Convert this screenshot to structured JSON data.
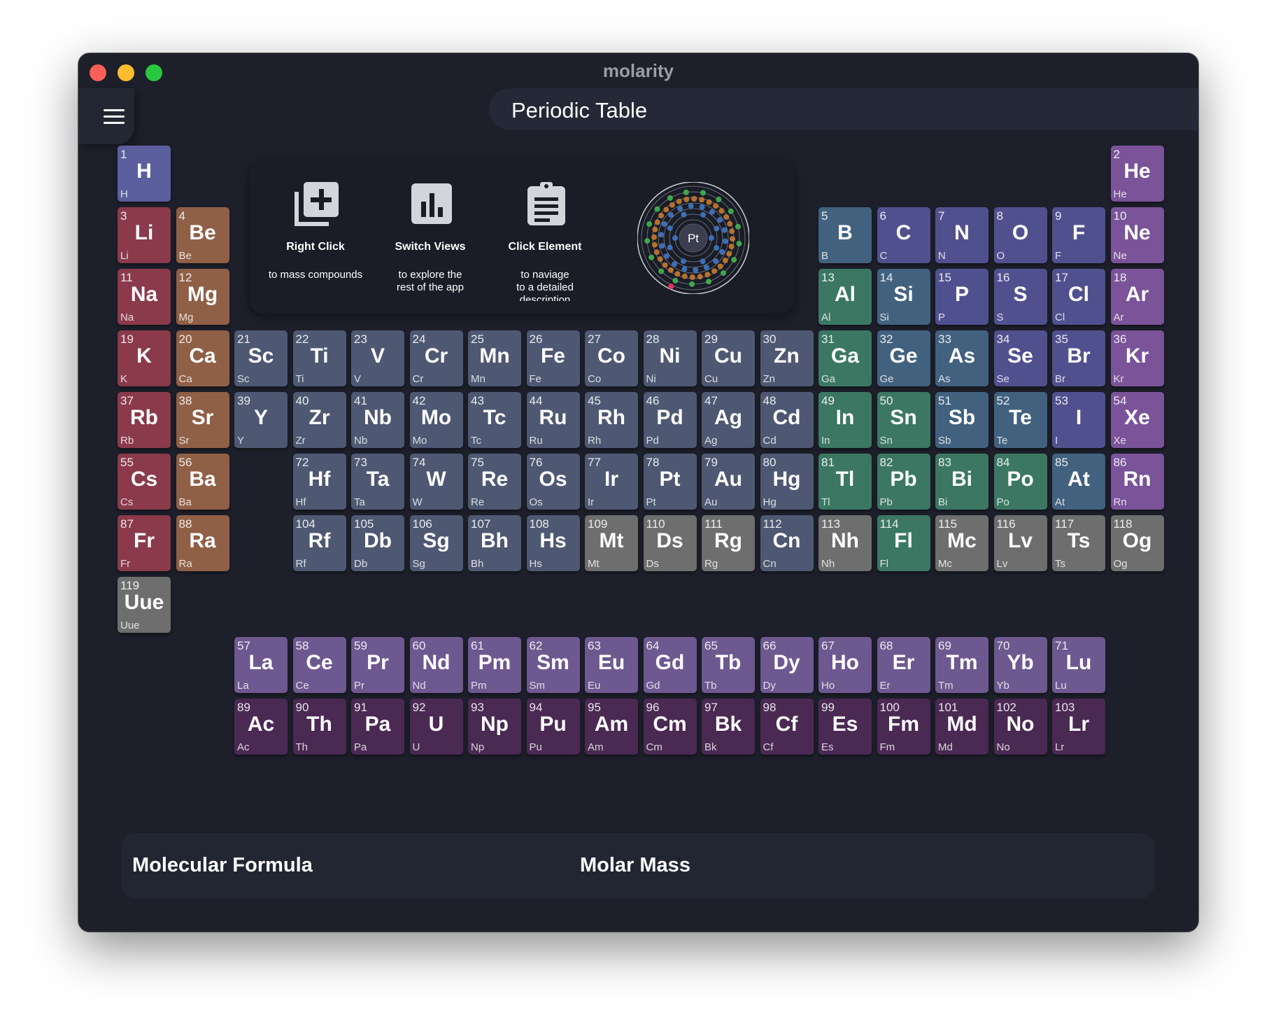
{
  "window": {
    "title": "molarity"
  },
  "header": {
    "title": "Periodic Table",
    "menu_icon": "hamburger-menu-icon"
  },
  "info": {
    "items": [
      {
        "icon": "add-box-icon",
        "title": "Right Click",
        "desc": [
          "to mass compounds"
        ]
      },
      {
        "icon": "bar-chart-icon",
        "title": "Switch Views",
        "desc": [
          "to explore the",
          "rest of the app"
        ]
      },
      {
        "icon": "clipboard-icon",
        "title": "Click Element",
        "desc": [
          "to naviage",
          "to a detailed",
          "description"
        ]
      }
    ],
    "atom_symbol": "Pt"
  },
  "bottom": {
    "formula_label": "Molecular Formula",
    "mass_label": "Molar Mass"
  },
  "colors": {
    "alkali": "#8a3a4b",
    "alkaline": "#8f5f46",
    "transition": "#4e5872",
    "post_transition": "#3b7763",
    "metalloid": "#41617f",
    "nonmetal": "#51508f",
    "noble": "#7a5399",
    "lanthanide": "#6d5890",
    "actinide": "#4a2953",
    "unknown": "#6e6e6e",
    "hydrogen": "#5c5f9d"
  },
  "elements": [
    {
      "n": 1,
      "s": "H",
      "c": "hydrogen"
    },
    {
      "n": 2,
      "s": "He",
      "c": "noble"
    },
    {
      "n": 3,
      "s": "Li",
      "c": "alkali"
    },
    {
      "n": 4,
      "s": "Be",
      "c": "alkaline"
    },
    {
      "n": 5,
      "s": "B",
      "c": "metalloid"
    },
    {
      "n": 6,
      "s": "C",
      "c": "nonmetal"
    },
    {
      "n": 7,
      "s": "N",
      "c": "nonmetal"
    },
    {
      "n": 8,
      "s": "O",
      "c": "nonmetal"
    },
    {
      "n": 9,
      "s": "F",
      "c": "nonmetal"
    },
    {
      "n": 10,
      "s": "Ne",
      "c": "noble"
    },
    {
      "n": 11,
      "s": "Na",
      "c": "alkali"
    },
    {
      "n": 12,
      "s": "Mg",
      "c": "alkaline"
    },
    {
      "n": 13,
      "s": "Al",
      "c": "post_transition"
    },
    {
      "n": 14,
      "s": "Si",
      "c": "metalloid"
    },
    {
      "n": 15,
      "s": "P",
      "c": "nonmetal"
    },
    {
      "n": 16,
      "s": "S",
      "c": "nonmetal"
    },
    {
      "n": 17,
      "s": "Cl",
      "c": "nonmetal"
    },
    {
      "n": 18,
      "s": "Ar",
      "c": "noble"
    },
    {
      "n": 19,
      "s": "K",
      "c": "alkali"
    },
    {
      "n": 20,
      "s": "Ca",
      "c": "alkaline"
    },
    {
      "n": 21,
      "s": "Sc",
      "c": "transition"
    },
    {
      "n": 22,
      "s": "Ti",
      "c": "transition"
    },
    {
      "n": 23,
      "s": "V",
      "c": "transition"
    },
    {
      "n": 24,
      "s": "Cr",
      "c": "transition"
    },
    {
      "n": 25,
      "s": "Mn",
      "c": "transition"
    },
    {
      "n": 26,
      "s": "Fe",
      "c": "transition"
    },
    {
      "n": 27,
      "s": "Co",
      "c": "transition"
    },
    {
      "n": 28,
      "s": "Ni",
      "c": "transition"
    },
    {
      "n": 29,
      "s": "Cu",
      "c": "transition"
    },
    {
      "n": 30,
      "s": "Zn",
      "c": "transition"
    },
    {
      "n": 31,
      "s": "Ga",
      "c": "post_transition"
    },
    {
      "n": 32,
      "s": "Ge",
      "c": "metalloid"
    },
    {
      "n": 33,
      "s": "As",
      "c": "metalloid"
    },
    {
      "n": 34,
      "s": "Se",
      "c": "nonmetal"
    },
    {
      "n": 35,
      "s": "Br",
      "c": "nonmetal"
    },
    {
      "n": 36,
      "s": "Kr",
      "c": "noble"
    },
    {
      "n": 37,
      "s": "Rb",
      "c": "alkali"
    },
    {
      "n": 38,
      "s": "Sr",
      "c": "alkaline"
    },
    {
      "n": 39,
      "s": "Y",
      "c": "transition"
    },
    {
      "n": 40,
      "s": "Zr",
      "c": "transition"
    },
    {
      "n": 41,
      "s": "Nb",
      "c": "transition"
    },
    {
      "n": 42,
      "s": "Mo",
      "c": "transition"
    },
    {
      "n": 43,
      "s": "Tc",
      "c": "transition"
    },
    {
      "n": 44,
      "s": "Ru",
      "c": "transition"
    },
    {
      "n": 45,
      "s": "Rh",
      "c": "transition"
    },
    {
      "n": 46,
      "s": "Pd",
      "c": "transition"
    },
    {
      "n": 47,
      "s": "Ag",
      "c": "transition"
    },
    {
      "n": 48,
      "s": "Cd",
      "c": "transition"
    },
    {
      "n": 49,
      "s": "In",
      "c": "post_transition"
    },
    {
      "n": 50,
      "s": "Sn",
      "c": "post_transition"
    },
    {
      "n": 51,
      "s": "Sb",
      "c": "metalloid"
    },
    {
      "n": 52,
      "s": "Te",
      "c": "metalloid"
    },
    {
      "n": 53,
      "s": "I",
      "c": "nonmetal"
    },
    {
      "n": 54,
      "s": "Xe",
      "c": "noble"
    },
    {
      "n": 55,
      "s": "Cs",
      "c": "alkali"
    },
    {
      "n": 56,
      "s": "Ba",
      "c": "alkaline"
    },
    {
      "n": 72,
      "s": "Hf",
      "c": "transition"
    },
    {
      "n": 73,
      "s": "Ta",
      "c": "transition"
    },
    {
      "n": 74,
      "s": "W",
      "c": "transition"
    },
    {
      "n": 75,
      "s": "Re",
      "c": "transition"
    },
    {
      "n": 76,
      "s": "Os",
      "c": "transition"
    },
    {
      "n": 77,
      "s": "Ir",
      "c": "transition"
    },
    {
      "n": 78,
      "s": "Pt",
      "c": "transition"
    },
    {
      "n": 79,
      "s": "Au",
      "c": "transition"
    },
    {
      "n": 80,
      "s": "Hg",
      "c": "transition"
    },
    {
      "n": 81,
      "s": "Tl",
      "c": "post_transition"
    },
    {
      "n": 82,
      "s": "Pb",
      "c": "post_transition"
    },
    {
      "n": 83,
      "s": "Bi",
      "c": "post_transition"
    },
    {
      "n": 84,
      "s": "Po",
      "c": "post_transition"
    },
    {
      "n": 85,
      "s": "At",
      "c": "metalloid"
    },
    {
      "n": 86,
      "s": "Rn",
      "c": "noble"
    },
    {
      "n": 87,
      "s": "Fr",
      "c": "alkali"
    },
    {
      "n": 88,
      "s": "Ra",
      "c": "alkaline"
    },
    {
      "n": 104,
      "s": "Rf",
      "c": "transition"
    },
    {
      "n": 105,
      "s": "Db",
      "c": "transition"
    },
    {
      "n": 106,
      "s": "Sg",
      "c": "transition"
    },
    {
      "n": 107,
      "s": "Bh",
      "c": "transition"
    },
    {
      "n": 108,
      "s": "Hs",
      "c": "transition"
    },
    {
      "n": 109,
      "s": "Mt",
      "c": "unknown"
    },
    {
      "n": 110,
      "s": "Ds",
      "c": "unknown"
    },
    {
      "n": 111,
      "s": "Rg",
      "c": "unknown"
    },
    {
      "n": 112,
      "s": "Cn",
      "c": "transition"
    },
    {
      "n": 113,
      "s": "Nh",
      "c": "unknown"
    },
    {
      "n": 114,
      "s": "Fl",
      "c": "post_transition"
    },
    {
      "n": 115,
      "s": "Mc",
      "c": "unknown"
    },
    {
      "n": 116,
      "s": "Lv",
      "c": "unknown"
    },
    {
      "n": 117,
      "s": "Ts",
      "c": "unknown"
    },
    {
      "n": 118,
      "s": "Og",
      "c": "unknown"
    },
    {
      "n": 119,
      "s": "Uue",
      "c": "unknown"
    },
    {
      "n": 57,
      "s": "La",
      "c": "lanthanide"
    },
    {
      "n": 58,
      "s": "Ce",
      "c": "lanthanide"
    },
    {
      "n": 59,
      "s": "Pr",
      "c": "lanthanide"
    },
    {
      "n": 60,
      "s": "Nd",
      "c": "lanthanide"
    },
    {
      "n": 61,
      "s": "Pm",
      "c": "lanthanide"
    },
    {
      "n": 62,
      "s": "Sm",
      "c": "lanthanide"
    },
    {
      "n": 63,
      "s": "Eu",
      "c": "lanthanide"
    },
    {
      "n": 64,
      "s": "Gd",
      "c": "lanthanide"
    },
    {
      "n": 65,
      "s": "Tb",
      "c": "lanthanide"
    },
    {
      "n": 66,
      "s": "Dy",
      "c": "lanthanide"
    },
    {
      "n": 67,
      "s": "Ho",
      "c": "lanthanide"
    },
    {
      "n": 68,
      "s": "Er",
      "c": "lanthanide"
    },
    {
      "n": 69,
      "s": "Tm",
      "c": "lanthanide"
    },
    {
      "n": 70,
      "s": "Yb",
      "c": "lanthanide"
    },
    {
      "n": 71,
      "s": "Lu",
      "c": "lanthanide"
    },
    {
      "n": 89,
      "s": "Ac",
      "c": "actinide"
    },
    {
      "n": 90,
      "s": "Th",
      "c": "actinide"
    },
    {
      "n": 91,
      "s": "Pa",
      "c": "actinide"
    },
    {
      "n": 92,
      "s": "U",
      "c": "actinide"
    },
    {
      "n": 93,
      "s": "Np",
      "c": "actinide"
    },
    {
      "n": 94,
      "s": "Pu",
      "c": "actinide"
    },
    {
      "n": 95,
      "s": "Am",
      "c": "actinide"
    },
    {
      "n": 96,
      "s": "Cm",
      "c": "actinide"
    },
    {
      "n": 97,
      "s": "Bk",
      "c": "actinide"
    },
    {
      "n": 98,
      "s": "Cf",
      "c": "actinide"
    },
    {
      "n": 99,
      "s": "Es",
      "c": "actinide"
    },
    {
      "n": 100,
      "s": "Fm",
      "c": "actinide"
    },
    {
      "n": 101,
      "s": "Md",
      "c": "actinide"
    },
    {
      "n": 102,
      "s": "No",
      "c": "actinide"
    },
    {
      "n": 103,
      "s": "Lr",
      "c": "actinide"
    }
  ]
}
